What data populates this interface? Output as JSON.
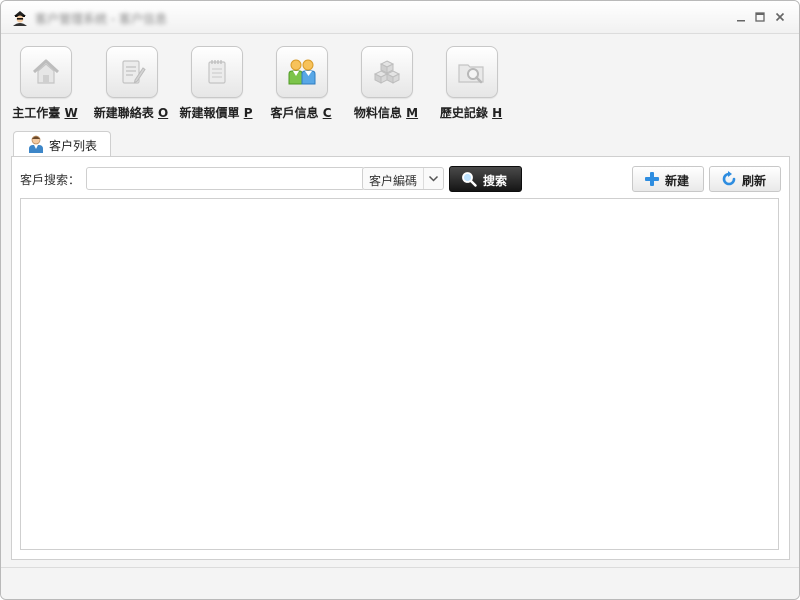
{
  "window": {
    "title": "客户管理系统 - 客户信息"
  },
  "toolbar": {
    "items": [
      {
        "label": "主工作臺",
        "hotkey": "W",
        "icon": "home-icon"
      },
      {
        "label": "新建聯絡表",
        "hotkey": "O",
        "icon": "notepad-pencil-icon"
      },
      {
        "label": "新建報價單",
        "hotkey": "P",
        "icon": "notepad-icon"
      },
      {
        "label": "客戶信息",
        "hotkey": "C",
        "icon": "customers-icon"
      },
      {
        "label": "物料信息",
        "hotkey": "M",
        "icon": "boxes-icon"
      },
      {
        "label": "歷史記錄",
        "hotkey": "H",
        "icon": "search-folder-icon"
      }
    ]
  },
  "tab": {
    "label": "客户列表"
  },
  "search": {
    "label": "客戶搜索：",
    "value": "",
    "placeholder": "",
    "field_select": "客户編碼",
    "search_button": "搜索",
    "new_button": "新建",
    "refresh_button": "刷新"
  },
  "colors": {
    "accent_blue": "#2e8de0",
    "search_button_bg": "#1e1e1e"
  }
}
